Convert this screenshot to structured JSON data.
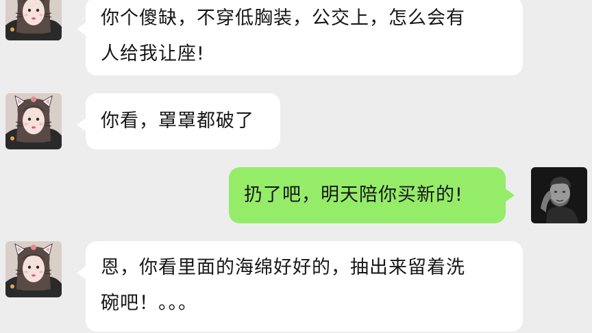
{
  "chat": {
    "messages": [
      {
        "sender": "female",
        "lines": [
          "你个傻缺，不穿低胸装，公交上，怎么会有",
          "人给我让座!"
        ]
      },
      {
        "sender": "female",
        "lines": [
          "你看，罩罩都破了"
        ]
      },
      {
        "sender": "male",
        "lines": [
          "扔了吧，明天陪你买新的!"
        ]
      },
      {
        "sender": "female",
        "lines": [
          "恩，你看里面的海绵好好的，抽出来留着洗",
          "碗吧！。。。"
        ]
      }
    ]
  },
  "icons": {
    "female_avatar": "cat-ear-girl-avatar",
    "male_avatar": "man-portrait-avatar"
  },
  "colors": {
    "background": "#ededed",
    "incoming_bubble": "#ffffff",
    "outgoing_bubble": "#95ec69",
    "text": "#161616"
  }
}
